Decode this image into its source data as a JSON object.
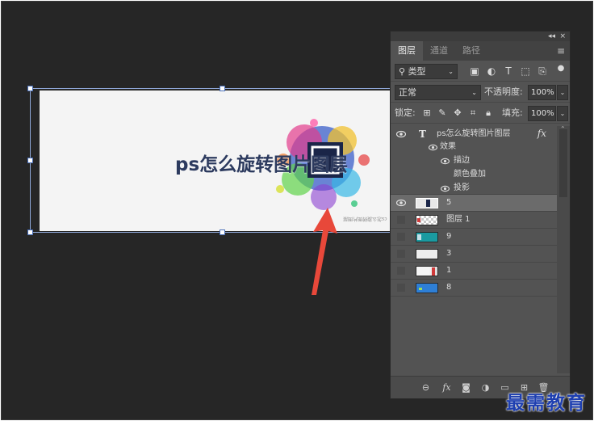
{
  "canvas": {
    "doc_title": "ps怎么旋转图片图层",
    "tiny_text": "cs怎么旋转图片图层"
  },
  "panel": {
    "topbar": {
      "collapse": "◂◂",
      "close": "×"
    },
    "tabs": [
      "图层",
      "通道",
      "路径"
    ],
    "menu_icon": "hamburger-menu-icon",
    "filter": {
      "label": "类型"
    },
    "blend": {
      "mode": "正常",
      "opacity_label": "不透明度:",
      "opacity_value": "100%"
    },
    "lock": {
      "label": "锁定:",
      "fill_label": "填充:",
      "fill_value": "100%"
    },
    "layers": [
      {
        "name": "ps怎么旋转图片图层",
        "type": "text",
        "visible": true,
        "fx": "fx",
        "effects_label": "效果",
        "effects": [
          "描边",
          "颜色叠加",
          "投影"
        ],
        "effects_visible": [
          true,
          false,
          true
        ]
      },
      {
        "name": "5",
        "visible": true,
        "selected": true,
        "thumb_color": "#e8e8e8"
      },
      {
        "name": "图层 1",
        "visible": false,
        "thumb_color": "#e0e0e0"
      },
      {
        "name": "9",
        "visible": false,
        "thumb_color": "#1a9aa0"
      },
      {
        "name": "3",
        "visible": false,
        "thumb_color": "#eeeeee"
      },
      {
        "name": "1",
        "visible": false,
        "thumb_color": "#f0f0f0"
      },
      {
        "name": "8",
        "visible": false,
        "thumb_color": "#2e7fd6"
      }
    ]
  },
  "watermark": "最需教育",
  "colors": {
    "accent_arrow": "#e8483a",
    "panel_bg": "#535353",
    "selected_layer": "#6b6b6b"
  }
}
